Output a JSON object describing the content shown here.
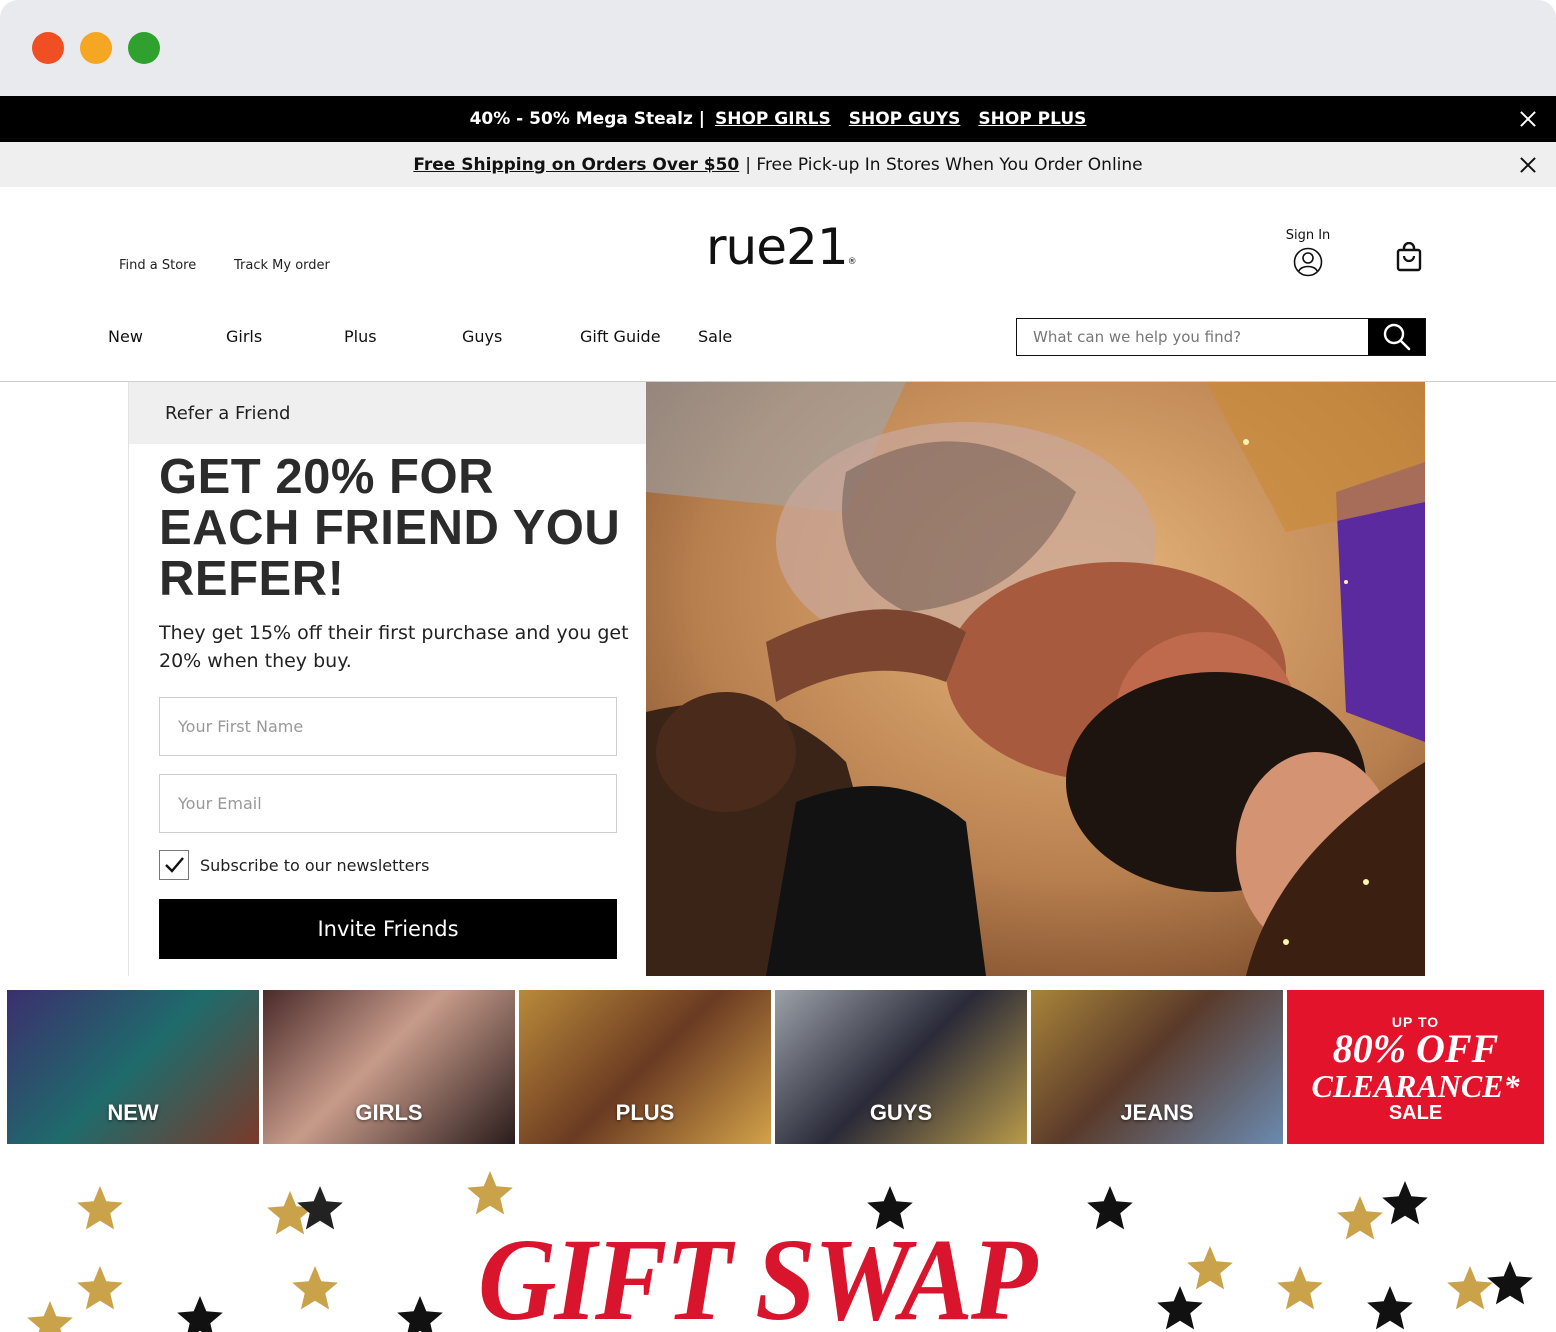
{
  "promo_bar": {
    "lead": "40% - 50% Mega Stealz |",
    "links": [
      "SHOP GIRLS",
      "SHOP GUYS",
      "SHOP PLUS"
    ]
  },
  "shipping_bar": {
    "link": "Free Shipping on Orders Over $50",
    "text": "| Free Pick-up In Stores When You Order Online"
  },
  "header": {
    "find_store": "Find a Store",
    "track_order": "Track My order",
    "logo": "rue21",
    "sign_in": "Sign In",
    "icons": [
      "user-icon",
      "shopping-bag-icon",
      "search-icon",
      "close-icon"
    ]
  },
  "nav": {
    "items": [
      "New",
      "Girls",
      "Plus",
      "Guys",
      "Gift Guide",
      "Sale"
    ]
  },
  "search": {
    "placeholder": "What can we help you find?"
  },
  "refer": {
    "header": "Refer a Friend",
    "headline": "GET 20% FOR EACH FRIEND YOU REFER!",
    "subtext": "They get 15% off their first purchase and you get 20% when they buy.",
    "first_name_placeholder": "Your First Name",
    "email_placeholder": "Your Email",
    "subscribe_label": "Subscribe to our newsletters",
    "subscribe_checked": true,
    "button": "Invite Friends"
  },
  "categories": {
    "tiles": [
      {
        "label": "NEW"
      },
      {
        "label": "GIRLS"
      },
      {
        "label": "PLUS"
      },
      {
        "label": "GUYS"
      },
      {
        "label": "JEANS"
      }
    ],
    "clearance": {
      "line1": "UP TO",
      "line2": "80% OFF",
      "line3": "CLEARANCE*",
      "line4": "SALE"
    }
  },
  "banner": {
    "title": "GIFT SWAP"
  },
  "colors": {
    "accent_red": "#e3132c",
    "black": "#000000"
  }
}
